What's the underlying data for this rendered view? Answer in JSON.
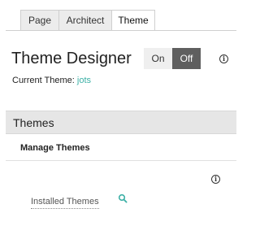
{
  "tabs": [
    {
      "label": "Page"
    },
    {
      "label": "Architect"
    },
    {
      "label": "Theme"
    }
  ],
  "header": {
    "title": "Theme Designer",
    "toggle_on": "On",
    "toggle_off": "Off",
    "toggle_state": "Off",
    "info_icon": "i"
  },
  "current_theme": {
    "label": "Current Theme:",
    "value": "jots"
  },
  "themes_section": {
    "title": "Themes",
    "manage_label": "Manage Themes",
    "info_icon": "i",
    "installed_label": "Installed Themes"
  },
  "colors": {
    "accent": "#3cb0a6",
    "toggle_active": "#5f5f5f"
  }
}
